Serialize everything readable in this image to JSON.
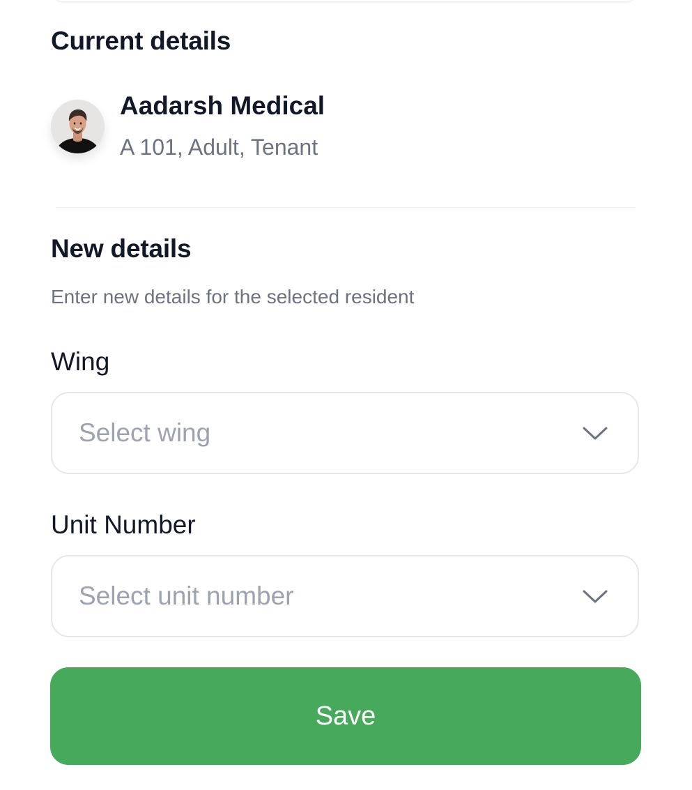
{
  "current": {
    "title": "Current details",
    "resident": {
      "name": "Aadarsh Medical",
      "meta": "A 101, Adult, Tenant",
      "avatar_icon": "person-avatar"
    }
  },
  "new_details": {
    "title": "New details",
    "helper": "Enter new details for the selected resident",
    "wing": {
      "label": "Wing",
      "placeholder": "Select wing",
      "icon": "chevron-down-icon"
    },
    "unit": {
      "label": "Unit Number",
      "placeholder": "Select unit number",
      "icon": "chevron-down-icon"
    },
    "save_label": "Save"
  },
  "colors": {
    "primary": "#47a95b",
    "text": "#111827",
    "muted": "#6b7280",
    "placeholder": "#9ca3af",
    "border": "#e5e7eb"
  }
}
